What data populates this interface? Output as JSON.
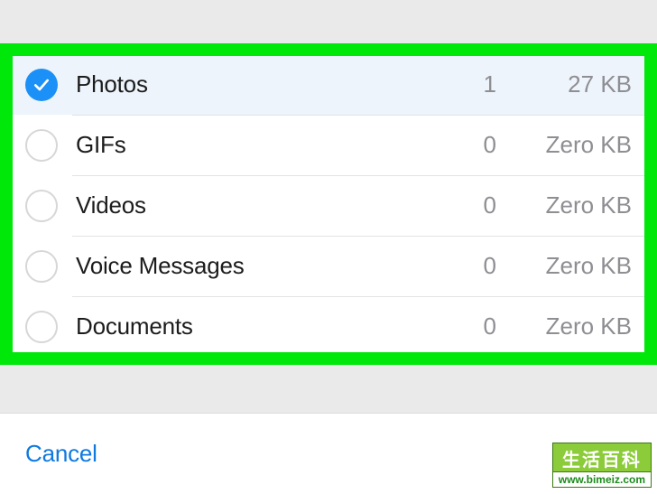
{
  "items": [
    {
      "label": "Photos",
      "count": "1",
      "size": "27 KB",
      "checked": true
    },
    {
      "label": "GIFs",
      "count": "0",
      "size": "Zero KB",
      "checked": false
    },
    {
      "label": "Videos",
      "count": "0",
      "size": "Zero KB",
      "checked": false
    },
    {
      "label": "Voice Messages",
      "count": "0",
      "size": "Zero KB",
      "checked": false
    },
    {
      "label": "Documents",
      "count": "0",
      "size": "Zero KB",
      "checked": false
    }
  ],
  "footer": {
    "cancel_label": "Cancel"
  },
  "watermark": {
    "title": "生活百科",
    "url": "www.bimeiz.com"
  }
}
